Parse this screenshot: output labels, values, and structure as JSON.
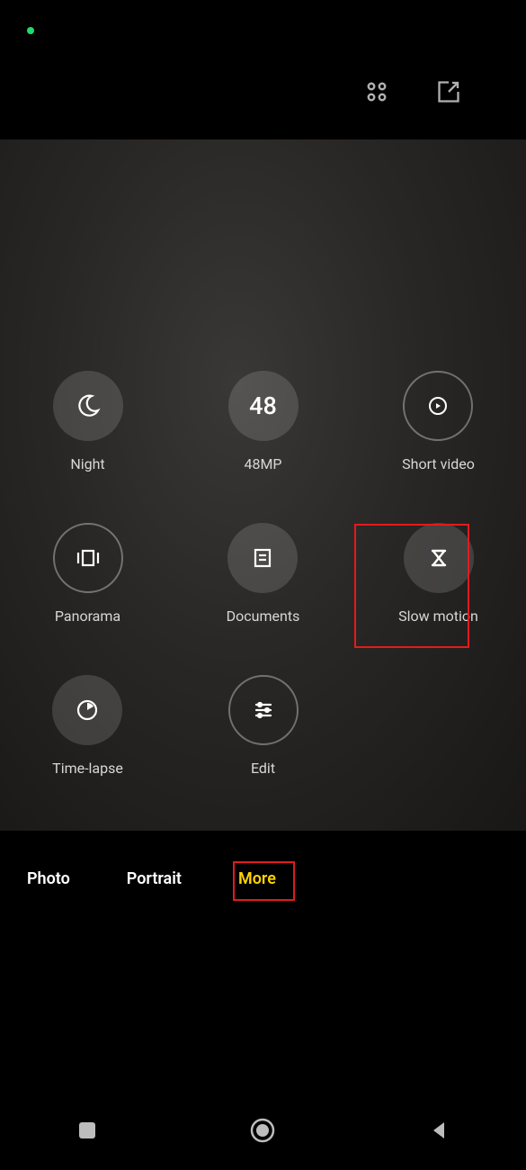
{
  "statusIndicator": "active",
  "modes": {
    "night": "Night",
    "mp48_text": "48",
    "mp48": "48MP",
    "shortVideo": "Short video",
    "panorama": "Panorama",
    "documents": "Documents",
    "slowMotion": "Slow motion",
    "timeLapse": "Time-lapse",
    "edit": "Edit"
  },
  "tabs": {
    "photo": "Photo",
    "portrait": "Portrait",
    "more": "More"
  }
}
